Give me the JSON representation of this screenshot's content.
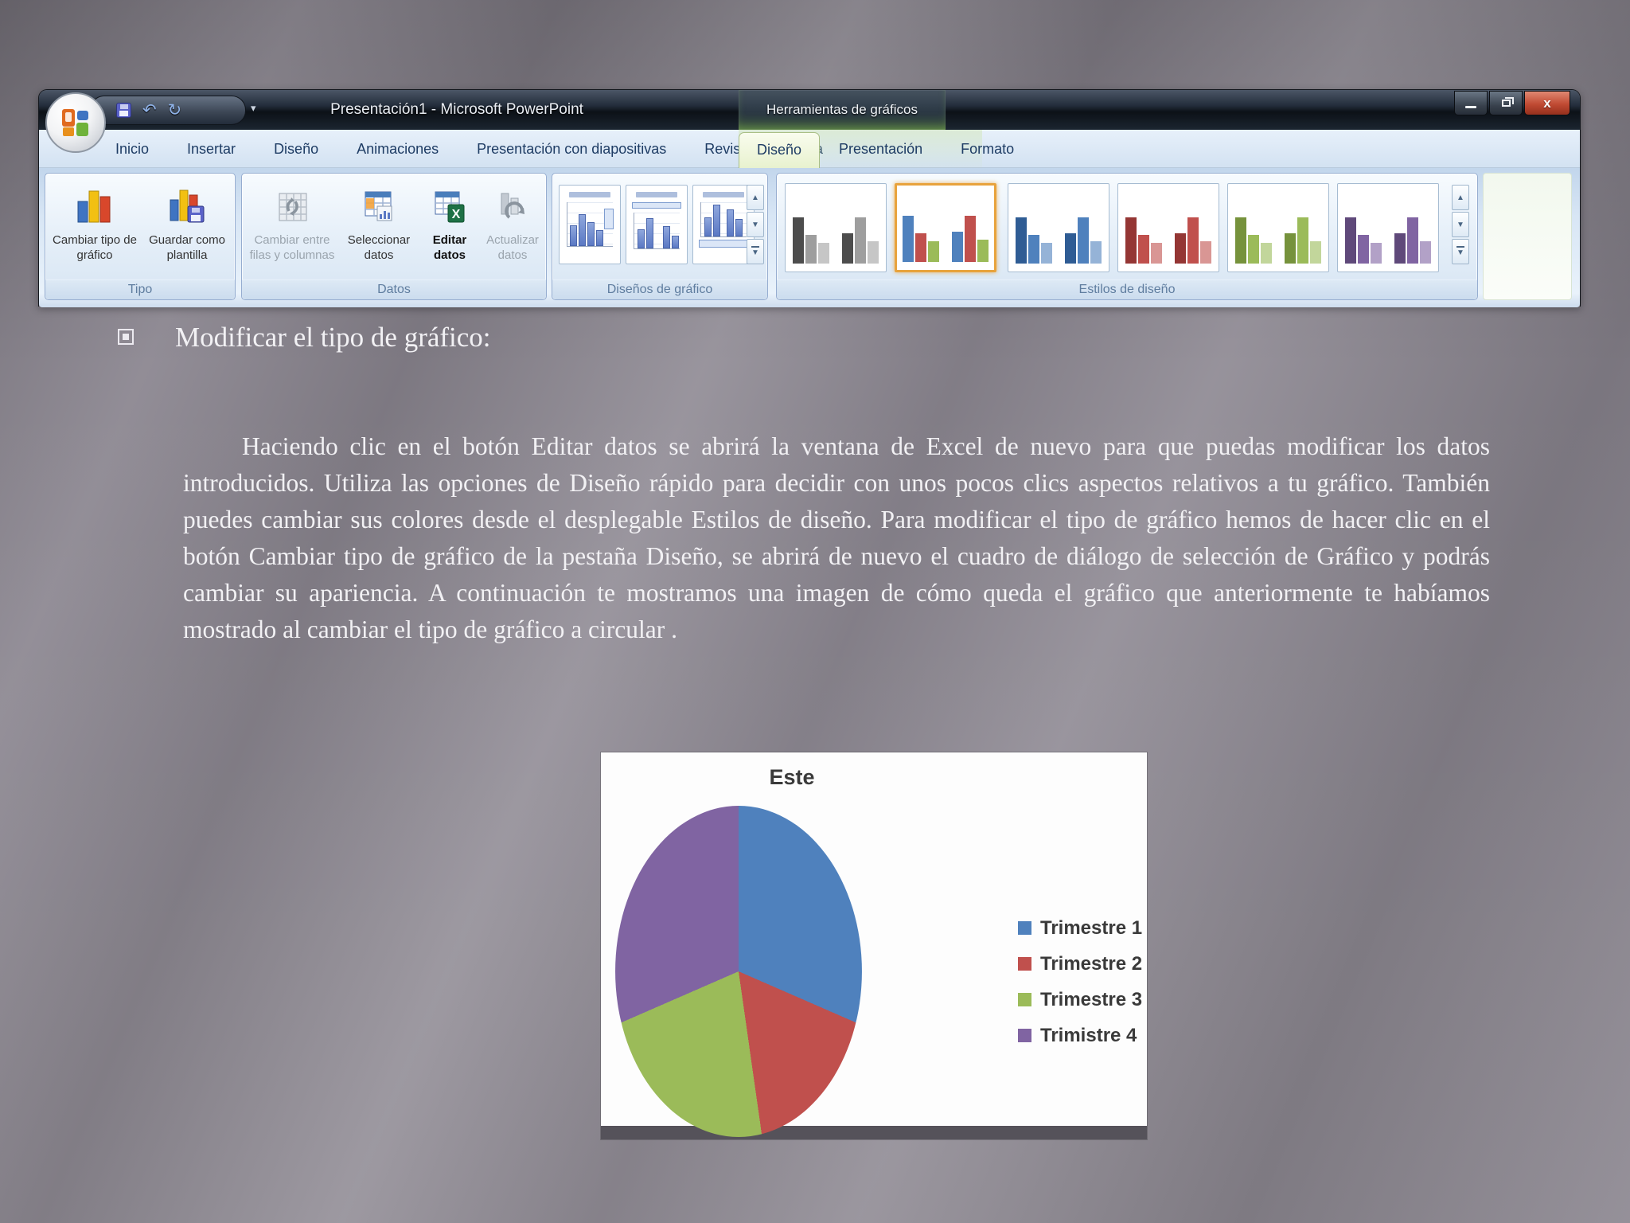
{
  "window": {
    "title": "Presentación1 - Microsoft PowerPoint",
    "contextual_title": "Herramientas de gráficos",
    "qat": {
      "save": "save",
      "undo_glyph": "↶",
      "redo_glyph": "↻",
      "customize_glyph": "▾"
    },
    "tabs": [
      "Inicio",
      "Insertar",
      "Diseño",
      "Animaciones",
      "Presentación con diapositivas",
      "Revisar",
      "Vista"
    ],
    "contextual_tabs": [
      "Diseño",
      "Presentación",
      "Formato"
    ],
    "active_contextual_tab": "Diseño",
    "window_controls": {
      "close_glyph": "x"
    },
    "help_glyph": "?",
    "ribbon": {
      "groups": {
        "tipo": {
          "label": "Tipo",
          "buttons": [
            {
              "label": "Cambiar tipo de gráfico"
            },
            {
              "label": "Guardar como plantilla"
            }
          ]
        },
        "datos": {
          "label": "Datos",
          "buttons": [
            {
              "label": "Cambiar entre filas y columnas",
              "disabled": true
            },
            {
              "label": "Seleccionar datos",
              "disabled": false
            },
            {
              "label": "Editar datos",
              "disabled": false,
              "emphasis": true
            },
            {
              "label": "Actualizar datos",
              "disabled": true
            }
          ]
        },
        "disenos": {
          "label": "Diseños de gráfico"
        },
        "estilos": {
          "label": "Estilos de diseño",
          "selected_index": 1
        }
      },
      "scroll_glyphs": {
        "up": "▲",
        "down": "▼",
        "more": "▼"
      },
      "style_palettes": [
        [
          "#4d4d4d",
          "#9e9e9e",
          "#c6c6c6"
        ],
        [
          "#4F81BD",
          "#C0504D",
          "#9BBB59"
        ],
        [
          "#2f5c94",
          "#4F81BD",
          "#95b3d7"
        ],
        [
          "#943634",
          "#C0504D",
          "#d99694"
        ],
        [
          "#76923c",
          "#9BBB59",
          "#c2d69b"
        ],
        [
          "#5f497a",
          "#8064A2",
          "#b2a1c7"
        ]
      ]
    }
  },
  "content": {
    "heading": "Modificar el tipo de gráfico:",
    "paragraph": "Haciendo clic en el botón Editar datos se abrirá la ventana de Excel de nuevo para que puedas modificar los datos introducidos. Utiliza las opciones de Diseño rápido para decidir con unos pocos clics aspectos relativos a tu gráfico. También puedes cambiar sus colores desde el desplegable Estilos de diseño. Para modificar el tipo de gráfico hemos de hacer clic en el botón Cambiar tipo de gráfico de la pestaña Diseño, se abrirá de nuevo el cuadro de diálogo de selección de Gráfico y podrás cambiar su apariencia. A continuación te mostramos una imagen de cómo queda el gráfico que anteriormente te habíamos mostrado al cambiar el tipo de gráfico a circular ."
  },
  "chart_data": {
    "type": "pie",
    "title": "Este",
    "labels": [
      "Trimestre 1",
      "Trimestre 2",
      "Trimestre 3",
      "Trimistre 4"
    ],
    "values": [
      30,
      17,
      23,
      30
    ],
    "colors": [
      "#4F81BD",
      "#C0504D",
      "#9BBB59",
      "#8064A2"
    ],
    "legend_position": "right",
    "start_angle_deg": 0
  }
}
